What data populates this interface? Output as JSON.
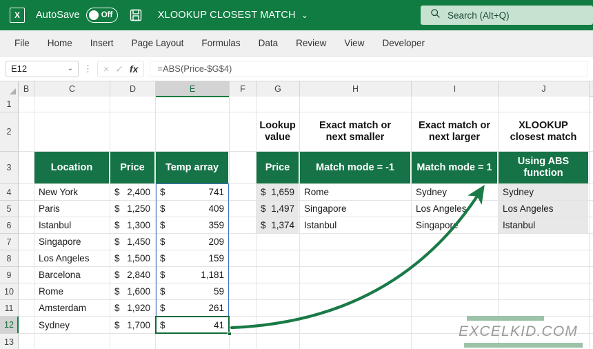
{
  "titlebar": {
    "app_icon": "excel-logo-icon",
    "autosave_label": "AutoSave",
    "autosave_state": "Off",
    "save_icon": "save-icon",
    "document_title": "XLOOKUP CLOSEST MATCH",
    "title_dropdown": "⌄",
    "search_icon": "search-icon",
    "search_placeholder": "Search (Alt+Q)",
    "bg_color": "#107c41"
  },
  "ribbon": {
    "tabs": [
      "File",
      "Home",
      "Insert",
      "Page Layout",
      "Formulas",
      "Data",
      "Review",
      "View",
      "Developer"
    ]
  },
  "formula_bar": {
    "name_box_value": "E12",
    "name_box_dropdown": "⌄",
    "cancel_icon": "×",
    "confirm_icon": "✓",
    "function_icon": "fx",
    "formula": "=ABS(Price-$G$4)"
  },
  "grid": {
    "column_headers": [
      "B",
      "C",
      "D",
      "E",
      "F",
      "G",
      "H",
      "I",
      "J"
    ],
    "selected_column": "E",
    "row_headers": [
      "1",
      "2",
      "3",
      "4",
      "5",
      "6",
      "7",
      "8",
      "9",
      "10",
      "11",
      "12",
      "13"
    ],
    "selected_row": "12"
  },
  "left_table": {
    "headers": [
      "Location",
      "Price",
      "Temp array"
    ],
    "rows": [
      {
        "location": "New York",
        "price_sym": "$",
        "price": "2,400",
        "temp_sym": "$",
        "temp": "741"
      },
      {
        "location": "Paris",
        "price_sym": "$",
        "price": "1,250",
        "temp_sym": "$",
        "temp": "409"
      },
      {
        "location": "Istanbul",
        "price_sym": "$",
        "price": "1,300",
        "temp_sym": "$",
        "temp": "359"
      },
      {
        "location": "Singapore",
        "price_sym": "$",
        "price": "1,450",
        "temp_sym": "$",
        "temp": "209"
      },
      {
        "location": "Los Angeles",
        "price_sym": "$",
        "price": "1,500",
        "temp_sym": "$",
        "temp": "159"
      },
      {
        "location": "Barcelona",
        "price_sym": "$",
        "price": "2,840",
        "temp_sym": "$",
        "temp": "1,181"
      },
      {
        "location": "Rome",
        "price_sym": "$",
        "price": "1,600",
        "temp_sym": "$",
        "temp": "59"
      },
      {
        "location": "Amsterdam",
        "price_sym": "$",
        "price": "1,920",
        "temp_sym": "$",
        "temp": "261"
      },
      {
        "location": "Sydney",
        "price_sym": "$",
        "price": "1,700",
        "temp_sym": "$",
        "temp": "41"
      }
    ]
  },
  "right_table": {
    "titles": [
      {
        "line1": "Lookup",
        "line2": "value"
      },
      {
        "line1": "Exact match or",
        "line2": "next smaller"
      },
      {
        "line1": "Exact match or",
        "line2": "next larger"
      },
      {
        "line1": "XLOOKUP",
        "line2": "closest match"
      }
    ],
    "headers": [
      {
        "line1": "Price",
        "line2": ""
      },
      {
        "line1": "Match mode = -1",
        "line2": ""
      },
      {
        "line1": "Match mode = 1",
        "line2": ""
      },
      {
        "line1": "Using ABS",
        "line2": "function"
      }
    ],
    "rows": [
      {
        "price_sym": "$",
        "price": "1,659",
        "smaller": "Rome",
        "larger": "Sydney",
        "abs": "Sydney"
      },
      {
        "price_sym": "$",
        "price": "1,497",
        "smaller": "Singapore",
        "larger": "Los Angeles",
        "abs": "Los Angeles"
      },
      {
        "price_sym": "$",
        "price": "1,374",
        "smaller": "Istanbul",
        "larger": "Singapore",
        "abs": "Istanbul"
      }
    ]
  },
  "annotation": {
    "arrow_color": "#1a7a47",
    "arrow_name": "curved-arrow-from-E12-to-J4"
  },
  "watermark": {
    "text": "EXCELKID.COM",
    "bar_color": "#9cc3a8",
    "text_color": "#9a9a9a"
  },
  "colors": {
    "title_green": "#107c41",
    "header_green": "#157347",
    "selection_blue": "#4472c4",
    "active_green": "#0e6b38"
  }
}
